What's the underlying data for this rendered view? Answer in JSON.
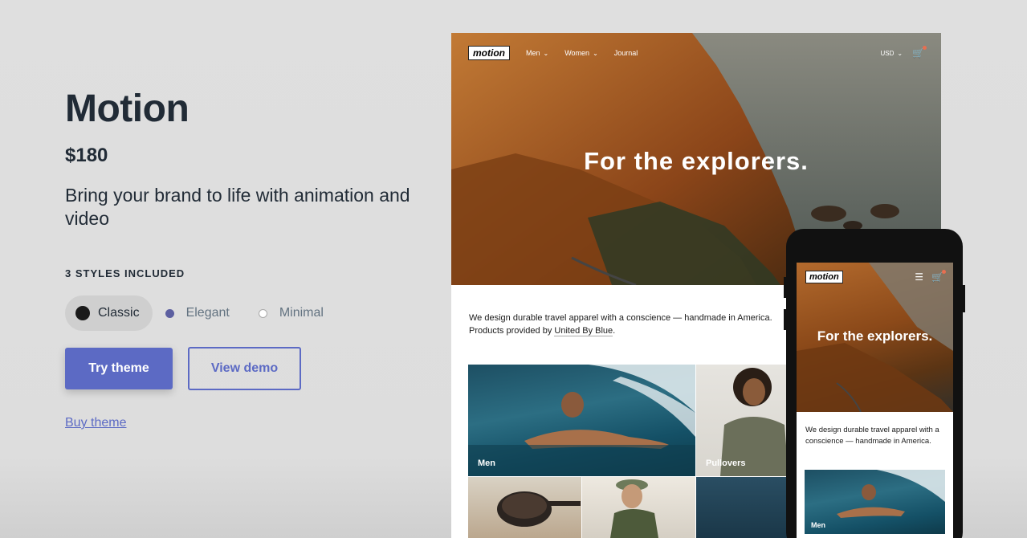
{
  "theme": {
    "name": "Motion",
    "price": "$180",
    "tagline": "Bring your brand to life with animation and video",
    "styles_heading": "3 STYLES INCLUDED",
    "styles": [
      {
        "label": "Classic",
        "color": "#1a1a1a",
        "selected": true
      },
      {
        "label": "Elegant",
        "color": "#5c5fa0",
        "selected": false
      },
      {
        "label": "Minimal",
        "color": "#ffffff",
        "selected": false
      }
    ],
    "try_label": "Try theme",
    "demo_label": "View demo",
    "buy_label": "Buy theme",
    "accent_color": "#5c6ac4"
  },
  "desktop_preview": {
    "logo": "motion",
    "nav": [
      "Men",
      "Women",
      "Journal"
    ],
    "currency": "USD",
    "hero_heading": "For the explorers.",
    "intro_line1": "We design durable travel apparel with a conscience — handmade in America.",
    "intro_line2_prefix": "Products provided by ",
    "intro_link": "United By Blue",
    "intro_line2_suffix": ".",
    "tiles": [
      "Men",
      "Pullovers"
    ]
  },
  "mobile_preview": {
    "logo": "motion",
    "hero_heading": "For the explorers.",
    "intro": "We design durable travel apparel with a conscience — handmade in America.",
    "tile": "Men"
  }
}
